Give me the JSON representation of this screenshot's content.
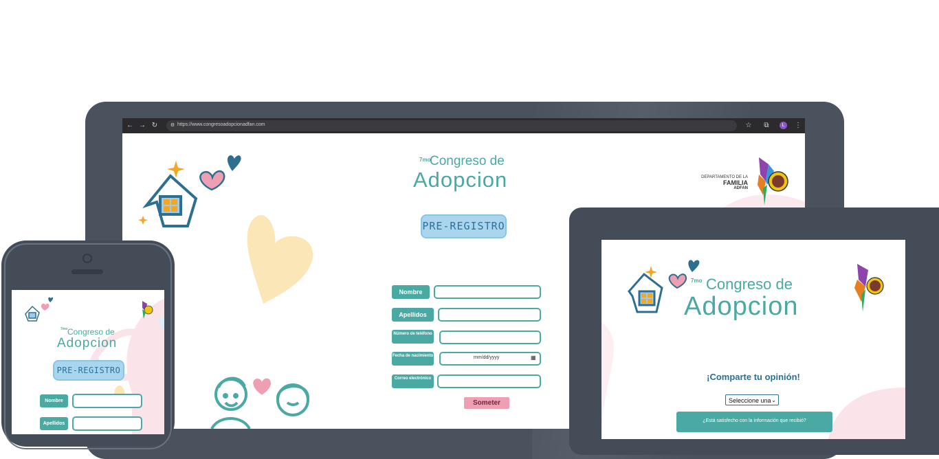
{
  "browser": {
    "url": "https://www.congresoadopcionadfan.com",
    "back_icon": "←",
    "forward_icon": "→",
    "reload_icon": "↻",
    "star_icon": "☆",
    "ext_icon": "⧉",
    "avatar_letter": "L",
    "menu_icon": "⋮"
  },
  "site": {
    "edition": "7mo",
    "title_line1": "Congreso de",
    "title_line2": "Adopcion",
    "prereg_label": "PRE-REGISTRO",
    "dept_line1": "DEPARTAMENTO DE LA",
    "dept_line2": "FAMILIA",
    "dept_line3": "ADFAN"
  },
  "form": {
    "fields": [
      {
        "label": "Nombre",
        "value": ""
      },
      {
        "label": "Apellidos",
        "value": ""
      },
      {
        "label": "Número de teléfono",
        "value": ""
      },
      {
        "label": "Fecha de nacimiento",
        "value": "",
        "placeholder": "mm/dd/yyyy"
      },
      {
        "label": "Correo electrónico",
        "value": ""
      }
    ],
    "submit_label": "Someter"
  },
  "tablet": {
    "heading": "¡Comparte tu opinión!",
    "select_value": "Seleccione una",
    "question": "¿Está satisfecho con la información que recibió?"
  },
  "colors": {
    "teal": "#4aa9a3",
    "pink": "#ef9fb3",
    "blue_button": "#a9d6ee",
    "device_frame": "#4a525e"
  }
}
